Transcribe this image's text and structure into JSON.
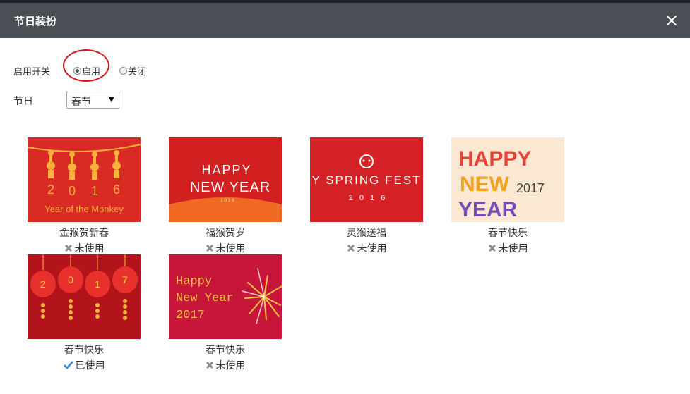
{
  "dialog": {
    "title": "节日装扮",
    "close_icon": "close-icon"
  },
  "settings": {
    "enable_label": "启用开关",
    "radio_on_label": "启用",
    "radio_off_label": "关闭",
    "enabled": true,
    "holiday_label": "节日",
    "holiday_value": "春节"
  },
  "themes": [
    {
      "name": "金猴贺新春",
      "status": "未使用",
      "used": false,
      "art_text": [
        "Year of the Monkey",
        "2",
        "0",
        "1",
        "6"
      ]
    },
    {
      "name": "福猴贺岁",
      "status": "未使用",
      "used": false,
      "art_text": [
        "HAPPY",
        "NEW YEAR",
        "2016"
      ]
    },
    {
      "name": "灵猴送福",
      "status": "未使用",
      "used": false,
      "art_text": [
        "Y SPRING FEST",
        "2  0  1  6"
      ]
    },
    {
      "name": "春节快乐",
      "status": "未使用",
      "used": false,
      "art_text": [
        "HAPPY",
        "NEW",
        "YEAR",
        "2017"
      ]
    },
    {
      "name": "春节快乐",
      "status": "已使用",
      "used": true,
      "art_text": [
        "2",
        "0",
        "1",
        "7"
      ]
    },
    {
      "name": "春节快乐",
      "status": "未使用",
      "used": false,
      "art_text": [
        "Happy",
        "New Year",
        "2017"
      ]
    }
  ],
  "colors": {
    "header_bg": "#4a4f55",
    "annotation_ring": "#d9141b",
    "used_check": "#2e86de",
    "unused_x": "#8a8a8a"
  }
}
